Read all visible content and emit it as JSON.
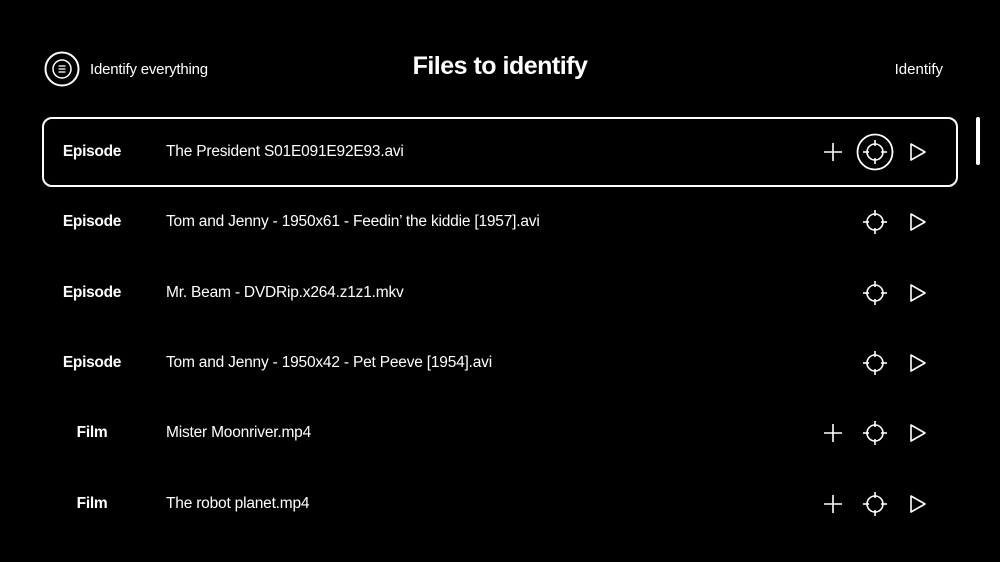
{
  "header": {
    "identify_everything_label": "Identify everything",
    "title": "Files to identify",
    "identify_label": "Identify"
  },
  "files": [
    {
      "type": "Episode",
      "name": "The President S01E091E92E93.avi",
      "selected": true,
      "actions": [
        "add",
        "identify",
        "play"
      ]
    },
    {
      "type": "Episode",
      "name": "Tom and Jenny - 1950x61 - Feedin’ the kiddie [1957].avi",
      "selected": false,
      "actions": [
        "identify",
        "play"
      ]
    },
    {
      "type": "Episode",
      "name": "Mr. Beam - DVDRip.x264.z1z1.mkv",
      "selected": false,
      "actions": [
        "identify",
        "play"
      ]
    },
    {
      "type": "Episode",
      "name": "Tom and Jenny - 1950x42 - Pet Peeve [1954].avi",
      "selected": false,
      "actions": [
        "identify",
        "play"
      ]
    },
    {
      "type": "Film",
      "name": "Mister Moonriver.mp4",
      "selected": false,
      "actions": [
        "add",
        "identify",
        "play"
      ]
    },
    {
      "type": "Film",
      "name": "The robot planet.mp4",
      "selected": false,
      "actions": [
        "add",
        "identify",
        "play"
      ]
    }
  ],
  "icons": {
    "identify_everything": "list-in-circle-icon",
    "add": "plus-icon",
    "identify": "crosshair-icon",
    "play": "play-icon"
  },
  "colors": {
    "background": "#000000",
    "foreground": "#ffffff"
  }
}
